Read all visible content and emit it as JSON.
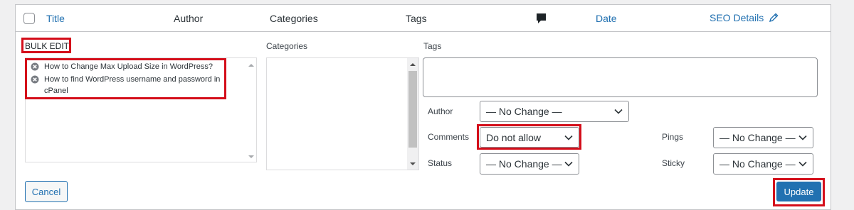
{
  "header": {
    "title": "Title",
    "author": "Author",
    "categories": "Categories",
    "tags": "Tags",
    "comments_icon": "comment-bubble-icon",
    "date": "Date",
    "seo": "SEO Details",
    "seo_icon": "pencil-icon"
  },
  "bulk_edit": {
    "heading": "BULK EDIT",
    "posts": [
      "How to Change Max Upload Size in WordPress?",
      "How to find WordPress username and password in",
      "cPanel"
    ],
    "categories_label": "Categories",
    "tags_label": "Tags",
    "tags_value": "",
    "fields": {
      "author": {
        "label": "Author",
        "value": "— No Change —"
      },
      "comments": {
        "label": "Comments",
        "value": "Do not allow"
      },
      "status": {
        "label": "Status",
        "value": "— No Change —"
      },
      "pings": {
        "label": "Pings",
        "value": "— No Change —"
      },
      "sticky": {
        "label": "Sticky",
        "value": "— No Change —"
      }
    },
    "cancel_label": "Cancel",
    "update_label": "Update"
  },
  "colors": {
    "accent": "#2271b1",
    "highlight": "#d40e1a",
    "background": "#f0f0f1"
  }
}
